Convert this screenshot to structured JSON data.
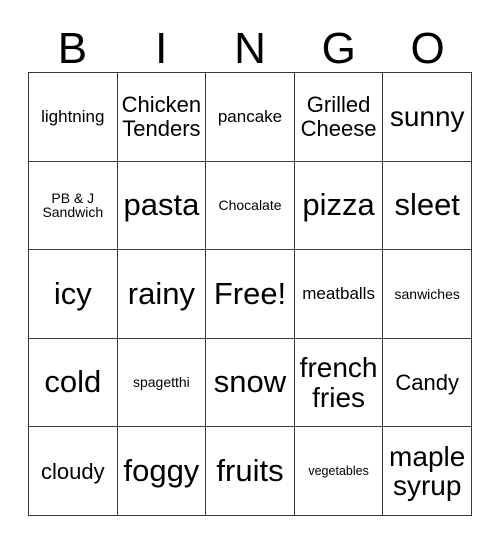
{
  "card": {
    "header_letters": [
      "B",
      "I",
      "N",
      "G",
      "O"
    ],
    "grid_size": 5,
    "free_space_label": "Free!",
    "colors": {
      "background": "#ffffff",
      "text": "#000000",
      "border": "#3a3a3a"
    },
    "rows": [
      [
        {
          "text": "lightning",
          "size": "fs-sm"
        },
        {
          "text": "Chicken Tenders",
          "size": "fs-md"
        },
        {
          "text": "pancake",
          "size": "fs-sm"
        },
        {
          "text": "Grilled Cheese",
          "size": "fs-md"
        },
        {
          "text": "sunny",
          "size": "fs-lg"
        }
      ],
      [
        {
          "text": "PB & J Sandwich",
          "size": "fs-xs"
        },
        {
          "text": "pasta",
          "size": "fs-xl"
        },
        {
          "text": "Chocalate",
          "size": "fs-xs"
        },
        {
          "text": "pizza",
          "size": "fs-xl"
        },
        {
          "text": "sleet",
          "size": "fs-xl"
        }
      ],
      [
        {
          "text": "icy",
          "size": "fs-xl"
        },
        {
          "text": "rainy",
          "size": "fs-xl"
        },
        {
          "text": "Free!",
          "size": "fs-xl"
        },
        {
          "text": "meatballs",
          "size": "fs-sm"
        },
        {
          "text": "sanwiches",
          "size": "fs-xs"
        }
      ],
      [
        {
          "text": "cold",
          "size": "fs-xl"
        },
        {
          "text": "spagetthi",
          "size": "fs-xs"
        },
        {
          "text": "snow",
          "size": "fs-xl"
        },
        {
          "text": "french fries",
          "size": "fs-lg"
        },
        {
          "text": "Candy",
          "size": "fs-md"
        }
      ],
      [
        {
          "text": "cloudy",
          "size": "fs-md"
        },
        {
          "text": "foggy",
          "size": "fs-xl"
        },
        {
          "text": "fruits",
          "size": "fs-xl"
        },
        {
          "text": "vegetables",
          "size": "fs-xxs"
        },
        {
          "text": "maple syrup",
          "size": "fs-lg"
        }
      ]
    ]
  }
}
